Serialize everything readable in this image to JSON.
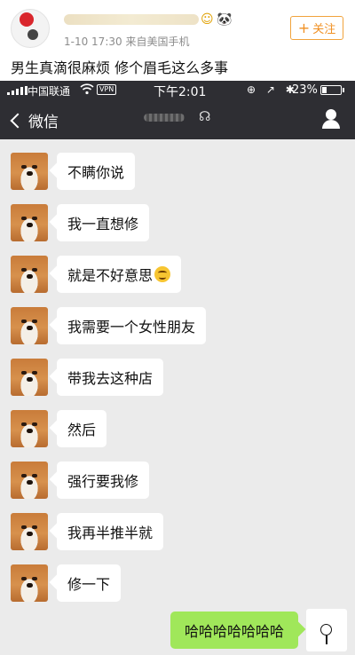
{
  "weibo": {
    "meta": "1-10 17:30  来自美国手机",
    "follow_label": "关注",
    "post_text": "男生真滴很麻烦 修个眉毛这么多事"
  },
  "status_bar": {
    "carrier": "中国联通",
    "vpn": "VPN",
    "time": "下午2:01",
    "icons": "⊕ ↗ ✱",
    "battery_text": "23%",
    "battery_level": 0.23
  },
  "nav": {
    "back_label": "微信"
  },
  "chat": {
    "incoming": [
      {
        "text": "不瞒你说",
        "emoji": ""
      },
      {
        "text": "我一直想修",
        "emoji": ""
      },
      {
        "text": "就是不好意思",
        "emoji": "smiling-face-emoji"
      },
      {
        "text": "我需要一个女性朋友",
        "emoji": ""
      },
      {
        "text": "带我去这种店",
        "emoji": ""
      },
      {
        "text": "然后",
        "emoji": ""
      },
      {
        "text": "强行要我修",
        "emoji": ""
      },
      {
        "text": "我再半推半就",
        "emoji": ""
      },
      {
        "text": "修一下",
        "emoji": ""
      }
    ],
    "outgoing": {
      "text": "哈哈哈哈哈哈哈"
    }
  },
  "colors": {
    "nav_bg": "#2e2e33",
    "chat_bg": "#ebebeb",
    "outgoing_bubble": "#a0e75a",
    "follow_orange": "#f09023"
  }
}
